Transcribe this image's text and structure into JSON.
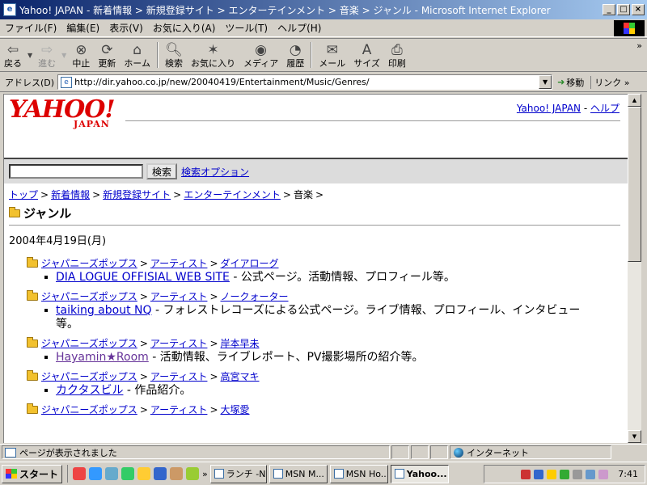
{
  "window": {
    "title": "Yahoo! JAPAN - 新着情報 > 新規登録サイト > エンターテインメント > 音楽 > ジャンル - Microsoft Internet Explorer"
  },
  "menu": [
    "ファイル(F)",
    "編集(E)",
    "表示(V)",
    "お気に入り(A)",
    "ツール(T)",
    "ヘルプ(H)"
  ],
  "toolbar": {
    "back": "戻る",
    "forward": "進む",
    "stop": "中止",
    "refresh": "更新",
    "home": "ホーム",
    "search": "検索",
    "favorites": "お気に入り",
    "media": "メディア",
    "history": "履歴",
    "mail": "メール",
    "size": "サイズ",
    "print": "印刷",
    "more": "»"
  },
  "address": {
    "label": "アドレス(D)",
    "url": "http://dir.yahoo.co.jp/new/20040419/Entertainment/Music/Genres/",
    "go": "移動",
    "links": "リンク"
  },
  "page": {
    "logo_main": "YAHOO!",
    "logo_sub": "JAPAN",
    "top_link_home": "Yahoo! JAPAN",
    "top_link_sep": " - ",
    "top_link_help": "ヘルプ",
    "search_button": "検索",
    "search_options": "検索オプション",
    "breadcrumb": [
      {
        "label": "トップ",
        "link": true
      },
      {
        "label": "新着情報",
        "link": true
      },
      {
        "label": "新規登録サイト",
        "link": true
      },
      {
        "label": "エンターテインメント",
        "link": true
      },
      {
        "label": "音楽",
        "link": false
      }
    ],
    "breadcrumb_sep": ">",
    "title": "ジャンル",
    "date": "2004年4月19日(月)",
    "entries": [
      {
        "cat1": "ジャパニーズポップス",
        "cat2": "アーティスト",
        "cat3": "ダイアローグ",
        "site": "DIA LOGUE OFFISIAL WEB SITE",
        "desc": " - 公式ページ。活動情報、プロフィール等。",
        "visited": false
      },
      {
        "cat1": "ジャパニーズポップス",
        "cat2": "アーティスト",
        "cat3": "ノークォーター",
        "site": "taiking about NQ",
        "desc": " - フォレストレコーズによる公式ページ。ライブ情報、プロフィール、インタビュー等。",
        "visited": false
      },
      {
        "cat1": "ジャパニーズポップス",
        "cat2": "アーティスト",
        "cat3": "岸本早未",
        "site": "Hayamin★Room",
        "desc": " - 活動情報、ライブレポート、PV撮影場所の紹介等。",
        "visited": true
      },
      {
        "cat1": "ジャパニーズポップス",
        "cat2": "アーティスト",
        "cat3": "高宮マキ",
        "site": "カクタスビル",
        "desc": " - 作品紹介。",
        "visited": false
      },
      {
        "cat1": "ジャパニーズポップス",
        "cat2": "アーティスト",
        "cat3": "大塚愛",
        "site": "",
        "desc": "",
        "visited": false
      }
    ]
  },
  "status": {
    "text": "ページが表示されました",
    "zone": "インターネット"
  },
  "taskbar": {
    "start": "スタート",
    "more": "»",
    "tasks": [
      "ランチ -NX",
      "MSN M...",
      "MSN Ho...",
      "Yahoo..."
    ],
    "active_index": 3,
    "clock": "7:41"
  },
  "colors": {
    "yahoo_red": "#dd0000",
    "link": "#0000cc",
    "visited": "#663399",
    "titlebar": "#0a246a"
  }
}
